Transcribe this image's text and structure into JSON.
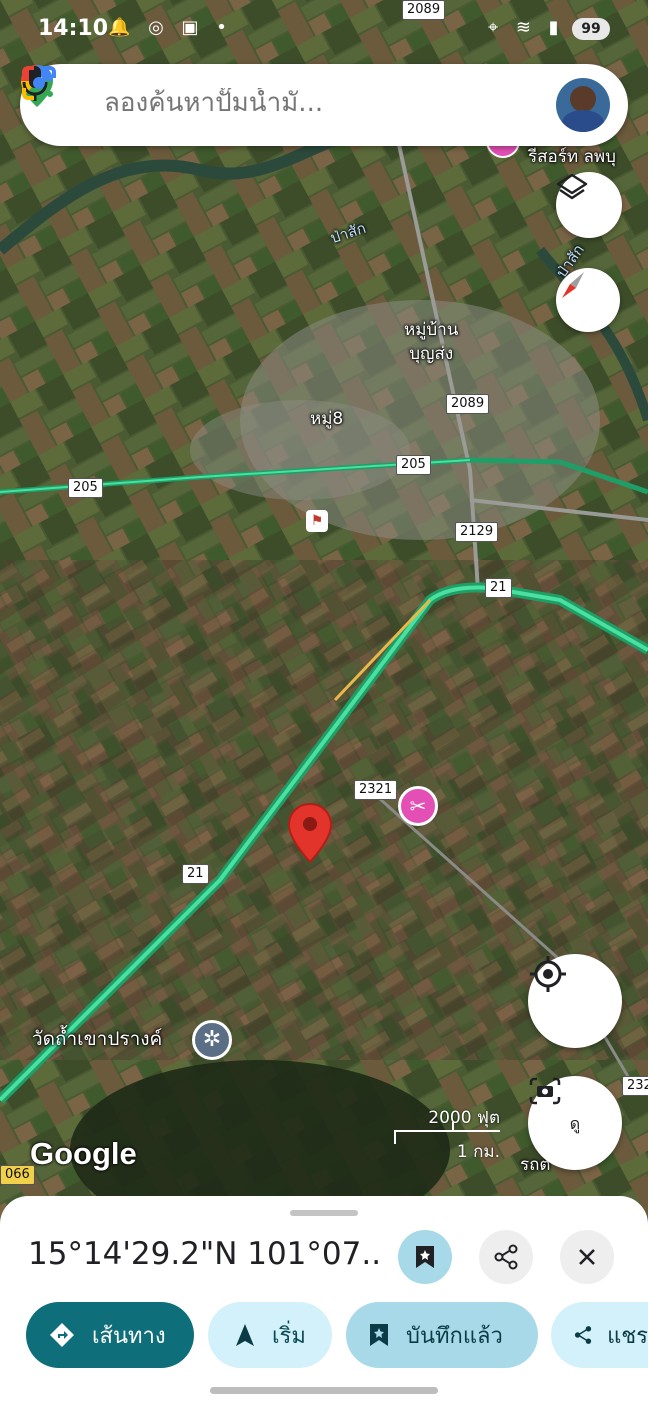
{
  "status_bar": {
    "time": "14:10",
    "left_icons": "🔔 ◎ ▣ •",
    "right_icons": "⌖ ≋ ▮",
    "battery": "99"
  },
  "search": {
    "placeholder": "ลองค้นหาปั๊มน้ำมั...",
    "mic_icon": "mic-icon",
    "lens_icon": "lens-icon"
  },
  "map": {
    "labels": {
      "resort": "รีสอร์ท ลพบุ",
      "river1": "ป่าสัก",
      "river2": "ป่าสัก",
      "village": "หมู่บ้าน\nบุญส่ง",
      "moo8": "หมู่8",
      "temple": "วัดถ้ำเขาปรางค์",
      "rot": "รถต"
    },
    "shields": {
      "r2089_top": "2089",
      "r2089": "2089",
      "r205_left": "205",
      "r205_mid": "205",
      "r2129": "2129",
      "r21_top": "21",
      "r2321": "2321",
      "r21_mid": "21",
      "r232": "232",
      "r066": "066"
    },
    "scale": {
      "top": "2000 ฟุต",
      "bottom": "1 กม."
    },
    "google": "Google",
    "camera_label": "ดู"
  },
  "sheet": {
    "coordinates": "15°14'29.2\"N 101°07...",
    "chips": {
      "directions": "เส้นทาง",
      "start": "เริ่ม",
      "saved": "บันทึกแล้ว",
      "share": "แชร"
    }
  },
  "colors": {
    "accent_dark": "#0e6e7a",
    "chip_light": "#d3f1fa",
    "chip_saved": "#a7d9e8",
    "route_green": "#31c98a",
    "pin_red": "#e2342b"
  }
}
